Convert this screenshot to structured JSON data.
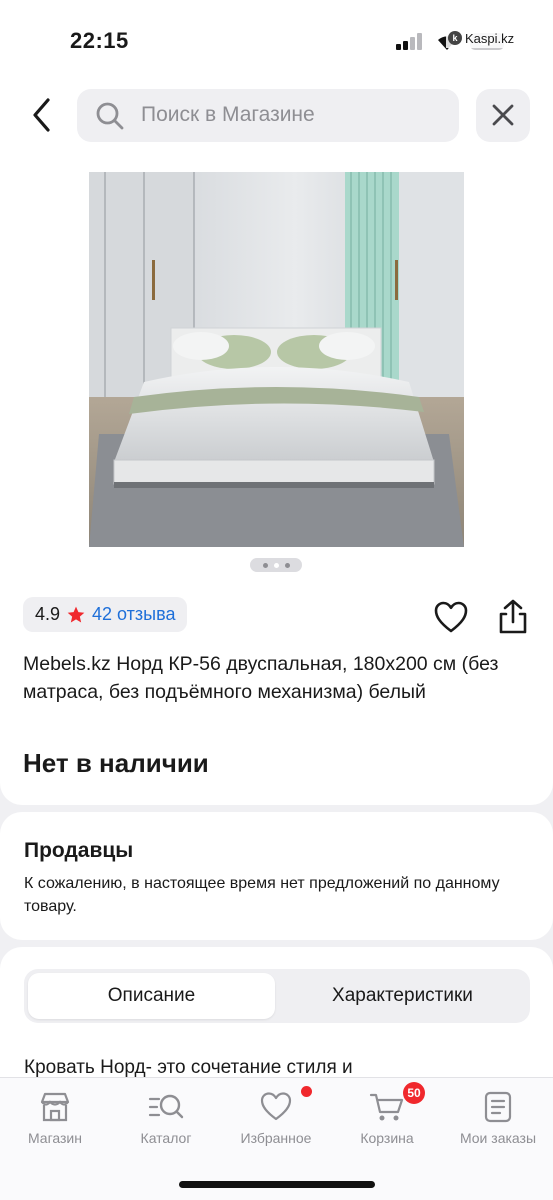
{
  "status_bar": {
    "time": "22:15",
    "battery": "15",
    "watermark": "Kaspi.kz"
  },
  "search": {
    "placeholder": "Поиск в Магазине"
  },
  "gallery": {
    "image_subject": "white double bed in bright bedroom",
    "current_page": 2,
    "total_pages": 3
  },
  "rating": {
    "value": "4.9",
    "reviews": "42 отзыва",
    "star_color": "#f0282d",
    "link_color": "#1e6fd9"
  },
  "product": {
    "title": "Mebels.kz Норд КР-56 двуспальная, 180x200 см (без матраса, без подъёмного механизма) белый",
    "stock_status": "Нет в наличии"
  },
  "sellers": {
    "title": "Продавцы",
    "message": "К сожалению, в настоящее время нет предложений по данному товару."
  },
  "tabs": [
    {
      "label": "Описание",
      "active": true
    },
    {
      "label": "Характеристики",
      "active": false
    }
  ],
  "description": {
    "text": "Кровать Норд- это сочетание стиля и"
  },
  "bottom_nav": [
    {
      "label": "Магазин",
      "icon": "shop-icon"
    },
    {
      "label": "Каталог",
      "icon": "catalog-search-icon"
    },
    {
      "label": "Избранное",
      "icon": "heart-icon",
      "dot": true
    },
    {
      "label": "Корзина",
      "icon": "cart-icon",
      "badge": "50"
    },
    {
      "label": "Мои заказы",
      "icon": "orders-icon"
    }
  ]
}
